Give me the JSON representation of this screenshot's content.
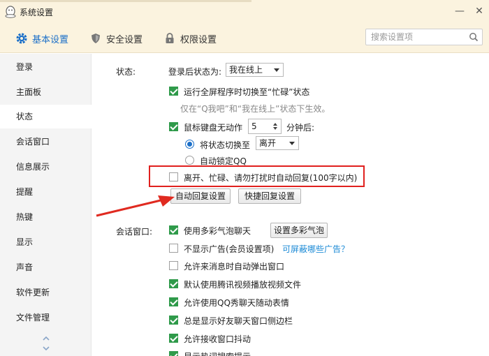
{
  "window": {
    "title": "系统设置",
    "minimize_glyph": "—",
    "close_glyph": "✕"
  },
  "tabs": [
    {
      "label": "基本设置",
      "icon": "gear-icon"
    },
    {
      "label": "安全设置",
      "icon": "shield-icon"
    },
    {
      "label": "权限设置",
      "icon": "lock-icon"
    }
  ],
  "search": {
    "placeholder": "搜索设置项"
  },
  "sidebar": {
    "items": [
      {
        "label": "登录"
      },
      {
        "label": "主面板"
      },
      {
        "label": "状态"
      },
      {
        "label": "会话窗口"
      },
      {
        "label": "信息展示"
      },
      {
        "label": "提醒"
      },
      {
        "label": "热键"
      },
      {
        "label": "显示"
      },
      {
        "label": "声音"
      },
      {
        "label": "软件更新"
      },
      {
        "label": "文件管理"
      }
    ],
    "active": "状态"
  },
  "status_section": {
    "heading": "状态:",
    "login_status_label": "登录后状态为:",
    "login_status_value": "我在线上",
    "fullscreen_busy": {
      "label": "运行全屏程序时切换至“忙碌”状态",
      "checked": true
    },
    "fullscreen_hint": "仅在“Q我吧”和“我在线上”状态下生效。",
    "idle": {
      "label": "鼠标键盘无动作",
      "checked": true,
      "minutes": "5",
      "suffix": "分钟后:"
    },
    "switch_to": {
      "label": "将状态切换至",
      "checked": true,
      "value": "离开"
    },
    "auto_lock": {
      "label": "自动锁定QQ",
      "checked": false
    },
    "auto_reply": {
      "label": "离开、忙碌、请勿打扰时自动回复(100字以内)",
      "checked": false
    },
    "auto_reply_settings_button": "自动回复设置",
    "quick_reply_settings_button": "快捷回复设置"
  },
  "chat_section": {
    "heading": "会话窗口:",
    "options": [
      {
        "label": "使用多彩气泡聊天",
        "checked": true
      },
      {
        "label": "不显示广告(会员设置项)",
        "checked": false
      },
      {
        "label": "允许来消息时自动弹出窗口",
        "checked": false
      },
      {
        "label": "默认使用腾讯视频播放视频文件",
        "checked": true
      },
      {
        "label": "允许使用QQ秀聊天随动表情",
        "checked": true
      },
      {
        "label": "总是显示好友聊天窗口侧边栏",
        "checked": true
      },
      {
        "label": "允许接收窗口抖动",
        "checked": true
      },
      {
        "label": "显示热词搜索提示",
        "checked": true
      }
    ],
    "bubble_settings_button": "设置多彩气泡",
    "ad_link": "可屏蔽哪些广告？"
  },
  "colors": {
    "accent": "#1b6fc8",
    "highlight": "#e0201e",
    "checkbox_green": "#2f9a4a",
    "titlebar": "#fbf3df"
  }
}
